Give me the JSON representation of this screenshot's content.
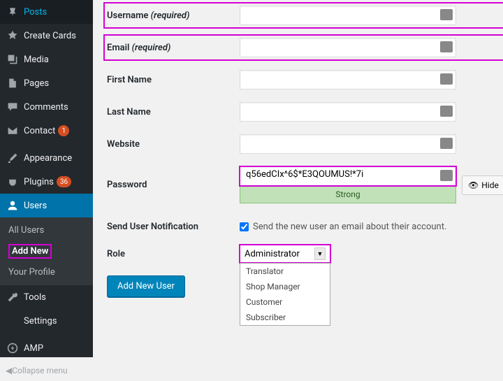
{
  "sidebar": {
    "posts": "Posts",
    "create_cards": "Create Cards",
    "media": "Media",
    "pages": "Pages",
    "comments": "Comments",
    "contact": "Contact",
    "contact_badge": "1",
    "appearance": "Appearance",
    "plugins": "Plugins",
    "plugins_badge": "36",
    "users": "Users",
    "all_users": "All Users",
    "add_new": "Add New",
    "your_profile": "Your Profile",
    "tools": "Tools",
    "settings": "Settings",
    "amp": "AMP",
    "collapse": "Collapse menu"
  },
  "form": {
    "username_label": "Username ",
    "required": "(required)",
    "email_label": "Email ",
    "firstname": "First Name",
    "lastname": "Last Name",
    "website": "Website",
    "password": "Password",
    "password_value": "q56edCIx^6$*E3QOUMUS!*7i",
    "strength": "Strong",
    "hide": "Hide",
    "notify_label": "Send User Notification",
    "notify_text": "Send the new user an email about their account.",
    "role": "Role",
    "role_selected": "Administrator",
    "role_options": [
      "Translator",
      "Shop Manager",
      "Customer",
      "Subscriber"
    ],
    "submit": "Add New User"
  }
}
